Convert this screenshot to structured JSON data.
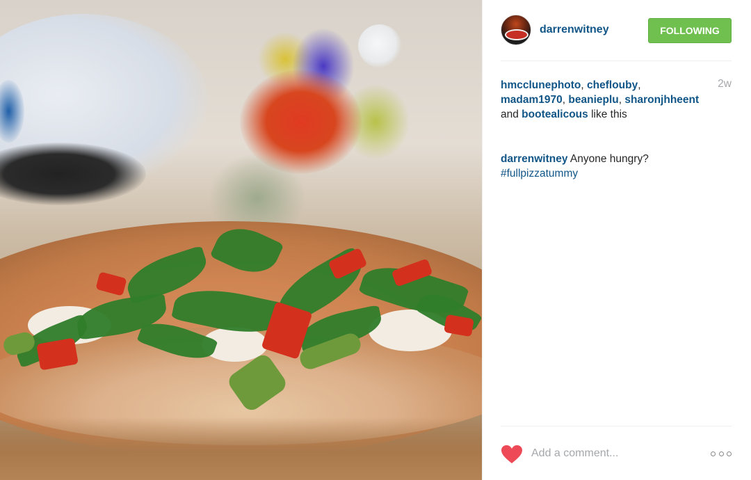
{
  "post": {
    "author": "darrenwitney",
    "follow_label": "FOLLOWING",
    "time_ago": "2w",
    "likes": {
      "users": [
        "hmcclunephoto",
        "cheflouby",
        "madam1970",
        "beanieplu",
        "sharonjhheent",
        "bootealicous"
      ],
      "and_text": " and ",
      "suffix": " like this"
    },
    "caption": {
      "user": "darrenwitney",
      "text": " Anyone hungry?",
      "hashtag": "#fullpizzatummy"
    },
    "comment_placeholder": "Add a comment...",
    "icons": {
      "like": "heart-icon",
      "more": "more-options-icon",
      "avatar": "avatar"
    },
    "colors": {
      "username": "#125688",
      "follow_button": "#70c050",
      "heart": "#ed4956"
    }
  }
}
